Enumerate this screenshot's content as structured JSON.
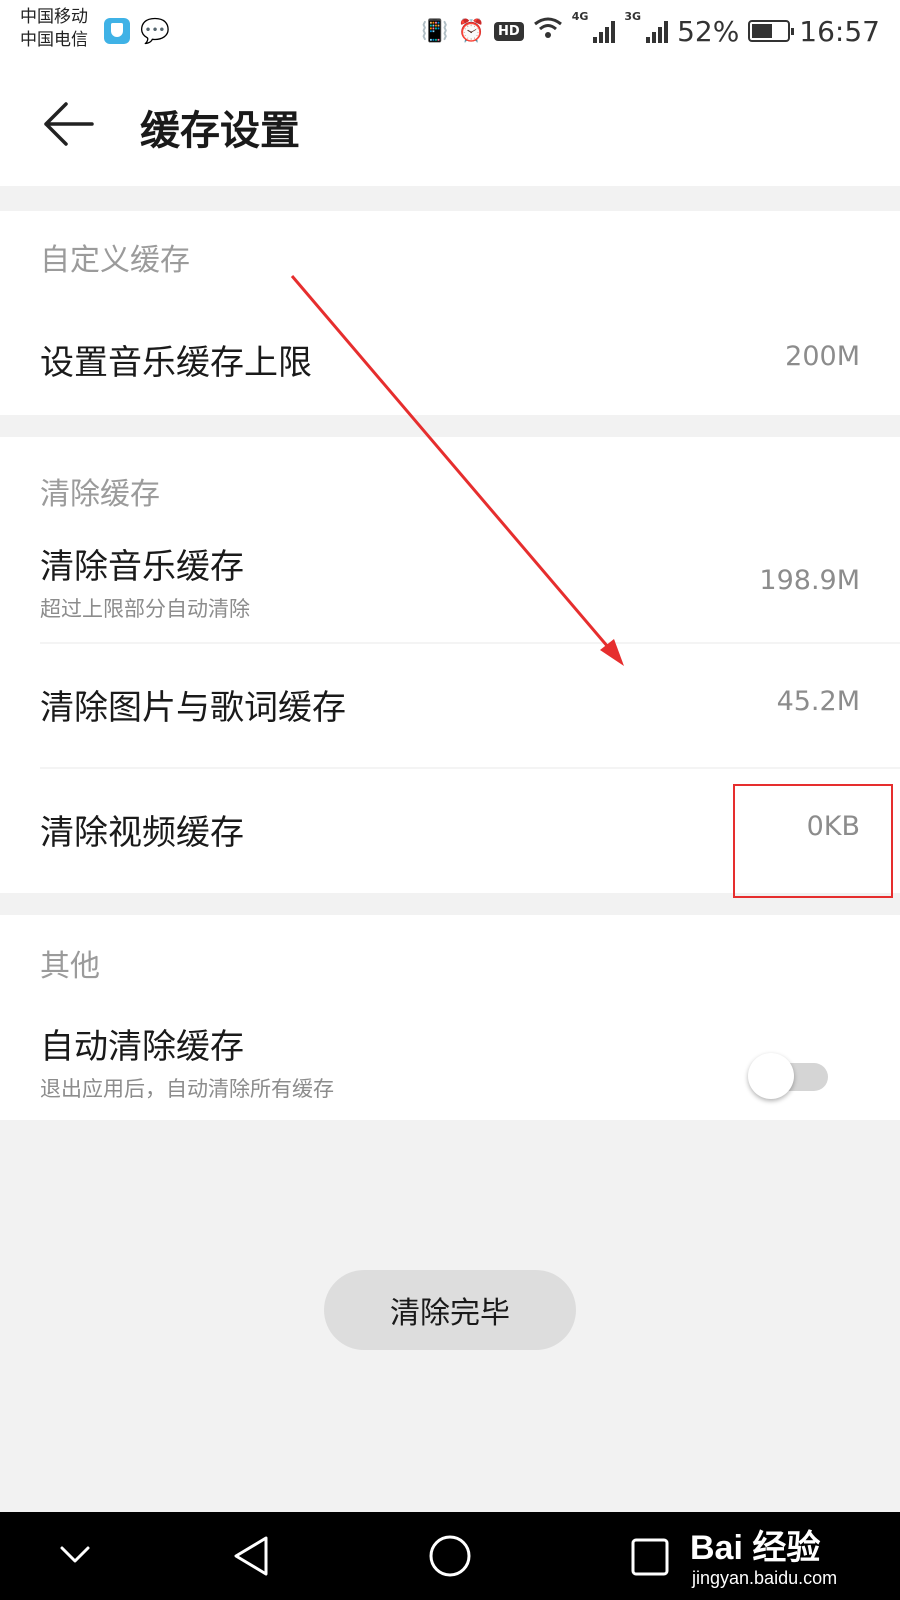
{
  "status_bar": {
    "carrier_1": "中国移动",
    "carrier_2": "中国电信",
    "network_1": "4G",
    "network_2": "3G",
    "battery": "52%",
    "time": "16:57",
    "hd_badge": "HD"
  },
  "header": {
    "title": "缓存设置"
  },
  "sections": {
    "custom": {
      "header": "自定义缓存",
      "music_limit": {
        "title": "设置音乐缓存上限",
        "value": "200M"
      }
    },
    "clear": {
      "header": "清除缓存",
      "music": {
        "title": "清除音乐缓存",
        "subtitle": "超过上限部分自动清除",
        "value": "198.9M"
      },
      "images_lyrics": {
        "title": "清除图片与歌词缓存",
        "value": "45.2M"
      },
      "video": {
        "title": "清除视频缓存",
        "value": "0KB"
      }
    },
    "other": {
      "header": "其他",
      "auto_clear": {
        "title": "自动清除缓存",
        "subtitle": "退出应用后，自动清除所有缓存",
        "enabled": false
      }
    }
  },
  "done_button": "清除完毕",
  "watermark": {
    "brand": "Bai 经验",
    "url": "jingyan.baidu.com"
  },
  "colors": {
    "annotation": "#e62e2e",
    "background": "#f2f2f2",
    "card": "#ffffff"
  }
}
